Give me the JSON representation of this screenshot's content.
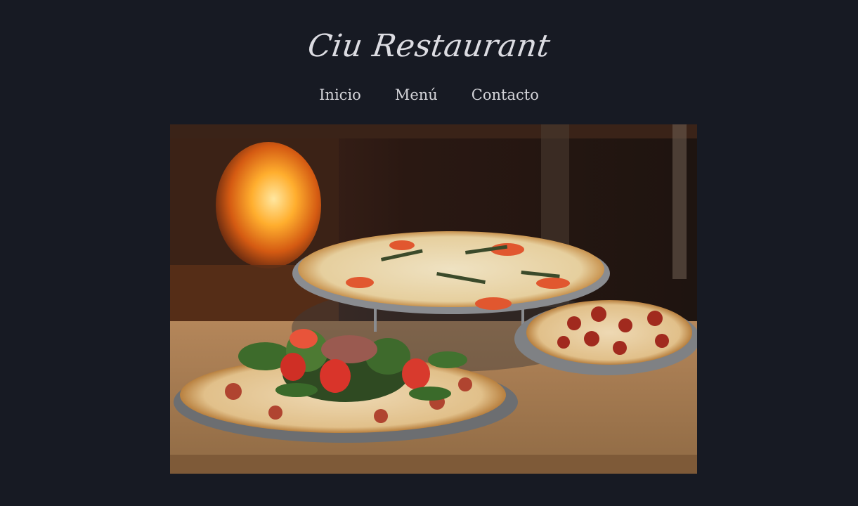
{
  "header": {
    "logo_text": "Ciu Restaurant"
  },
  "nav": {
    "items": [
      {
        "label": "Inicio"
      },
      {
        "label": "Menú"
      },
      {
        "label": "Contacto"
      }
    ]
  },
  "colors": {
    "background": "#171a23",
    "text": "#d7d7dc"
  },
  "hero": {
    "alt": "Pizzas en la mesa frente al horno de leña"
  }
}
